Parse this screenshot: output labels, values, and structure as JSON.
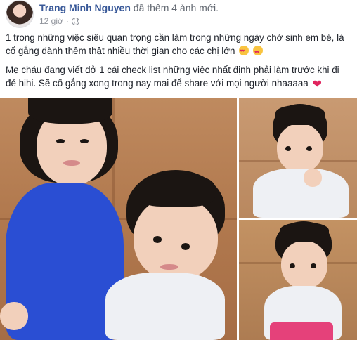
{
  "post": {
    "author": "Trang Minh Nguyen",
    "action": "đã thêm 4 ảnh mới.",
    "timestamp": "12 giờ",
    "privacy_icon": "globe-icon",
    "paragraphs": [
      "1 trong những việc siêu quan trọng cần làm trong những ngày chờ sinh em bé, là cố gắng dành thêm thật nhiều thời gian cho các chị lớn",
      "Mẹ cháu đang viết dở 1 cái check list những việc nhất định phải làm trước khi đi đẻ hihi. Sẽ cố gắng xong trong nay mai để share với mọi người nhaaaaa"
    ],
    "emojis": [
      "smiling-face-with-hearts-emoji",
      "heart-eyes-emoji",
      "red-heart-emoji"
    ]
  },
  "colors": {
    "author_link": "#385898",
    "meta_gray": "#90949c",
    "text": "#1d2129"
  }
}
